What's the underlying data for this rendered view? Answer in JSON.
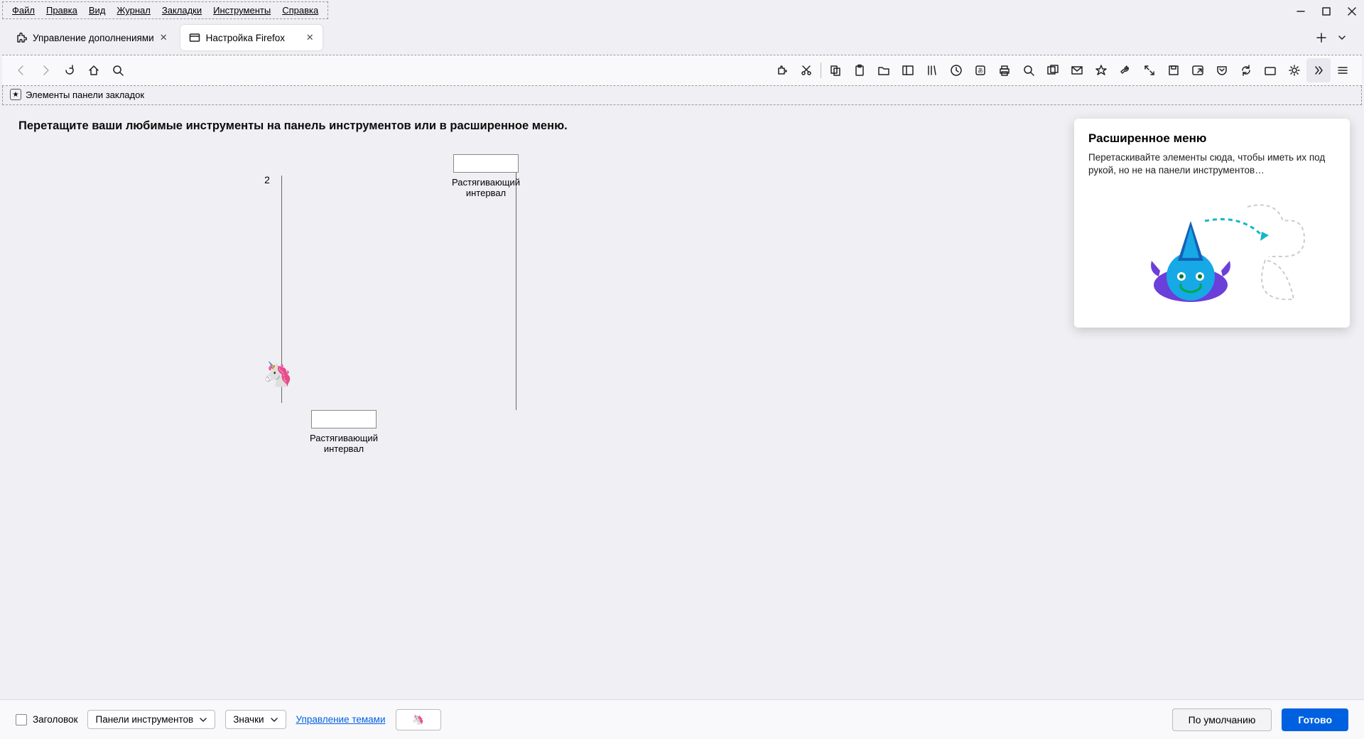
{
  "menu": {
    "file": "Файл",
    "edit": "Правка",
    "view": "Вид",
    "history": "Журнал",
    "bookmarks": "Закладки",
    "tools": "Инструменты",
    "help": "Справка"
  },
  "tabs": {
    "tab0": {
      "label": "Управление дополнениями"
    },
    "tab1": {
      "label": "Настройка Firefox"
    }
  },
  "bookmarksBar": {
    "label": "Элементы панели закладок"
  },
  "customize": {
    "heading": "Перетащите ваши любимые инструменты на панель инструментов или в расширенное меню.",
    "badge2": "2",
    "flexspace1": "Растягивающий интервал",
    "flexspace2": "Растягивающий интервал"
  },
  "overflow": {
    "title": "Расширенное меню",
    "body": "Перетаскивайте элементы сюда, чтобы иметь их под рукой, но не на панели инструментов…"
  },
  "footer": {
    "titlebar": "Заголовок",
    "toolbars": "Панели инструментов",
    "density": "Значки",
    "themes": "Управление темами",
    "defaults": "По умолчанию",
    "done": "Готово"
  }
}
